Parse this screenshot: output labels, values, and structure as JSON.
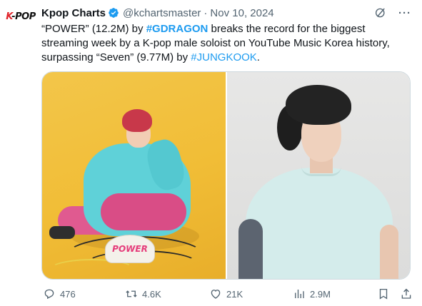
{
  "avatar": {
    "logo": "K-POP",
    "logo_k": "K",
    "logo_rest": "-POP"
  },
  "tweet": {
    "display_name": "Kpop Charts",
    "handle": "@kchartsmaster",
    "separator": "·",
    "date": "Nov 10, 2024",
    "text": {
      "part1": "“POWER” (12.2M) by ",
      "hashtag1": "#GDRAGON",
      "part2": " breaks the record for the biggest streaming week by a K-pop male soloist on YouTube Music Korea history, surpassing “Seven” (9.77M) by ",
      "hashtag2": "#JUNGKOOK",
      "part3": "."
    },
    "media": {
      "cap_text": "POWER"
    },
    "actions": {
      "replies": "476",
      "retweets": "4.6K",
      "likes": "21K",
      "views": "2.9M"
    }
  },
  "icons": {
    "verified": "verified-badge-icon",
    "grok": "grok-icon",
    "more": "more-icon",
    "reply": "reply-icon",
    "retweet": "retweet-icon",
    "like": "heart-icon",
    "views": "views-icon",
    "bookmark": "bookmark-icon",
    "share": "share-icon"
  },
  "colors": {
    "link": "#1d9bf0",
    "text": "#0f1419",
    "muted": "#536471",
    "verified": "#1d9bf0"
  }
}
